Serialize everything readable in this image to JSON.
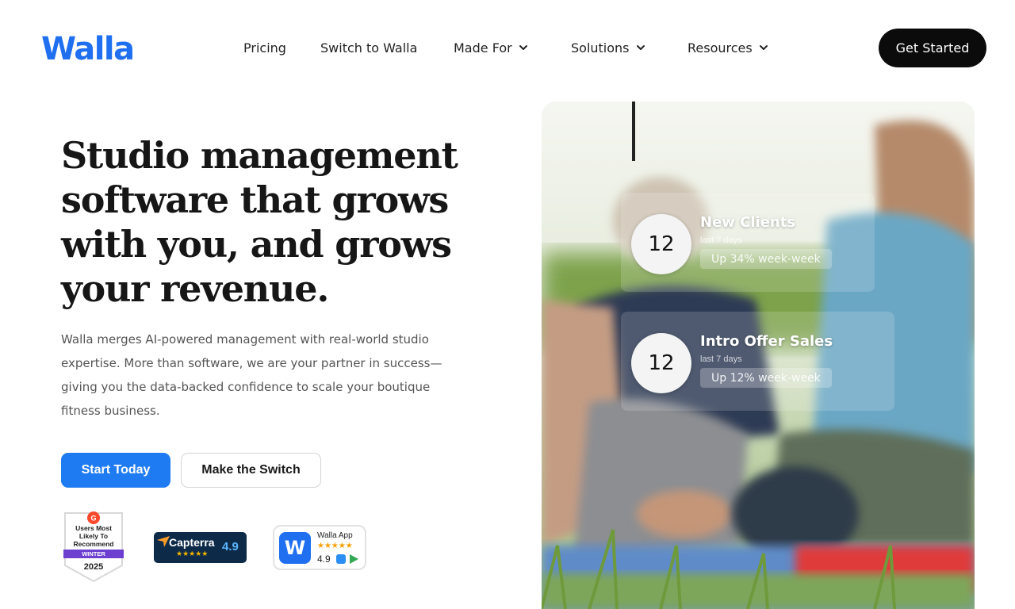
{
  "header": {
    "logo": "Walla",
    "nav": [
      {
        "label": "Pricing"
      },
      {
        "label": "Switch to Walla"
      },
      {
        "label": "Made For"
      },
      {
        "label": "Solutions"
      },
      {
        "label": "Resources"
      }
    ],
    "cta": "Get Started"
  },
  "hero": {
    "headline": "Studio management software that grows with you, and grows your revenue.",
    "subtext": "Walla merges AI-powered management with real-world studio expertise. More than software, we are your partner in success—giving you the data-backed confidence to scale your boutique fitness business.",
    "primary_button": "Start Today",
    "secondary_button": "Make the Switch"
  },
  "badges": {
    "g2": {
      "lines": [
        "Users Most",
        "Likely To",
        "Recommend"
      ],
      "season": "WINTER",
      "year": "2025"
    },
    "capterra": {
      "name": "Capterra",
      "stars": "★★★★★",
      "score": "4.9"
    },
    "walla_app": {
      "icon_letter": "W",
      "name": "Walla App",
      "stars": "★★★★★",
      "score": "4.9"
    }
  },
  "stats": [
    {
      "value": "12",
      "title": "New Clients",
      "subtitle": "last 7 days",
      "change": "Up 34% week-week"
    },
    {
      "value": "12",
      "title": "Intro Offer Sales",
      "subtitle": "last 7 days",
      "change": "Up 12% week-week"
    }
  ],
  "colors": {
    "brand_blue": "#1f6ff0",
    "primary_button": "#1f7bf2",
    "cta_dark": "#0b0b0b",
    "capterra_navy": "#0d2b48"
  },
  "icons": {
    "nav_dropdown": "chevron-down-icon",
    "g2": "g2-logo-icon",
    "capterra": "capterra-logo-icon",
    "apple_store": "app-store-icon",
    "google_play": "google-play-icon"
  }
}
